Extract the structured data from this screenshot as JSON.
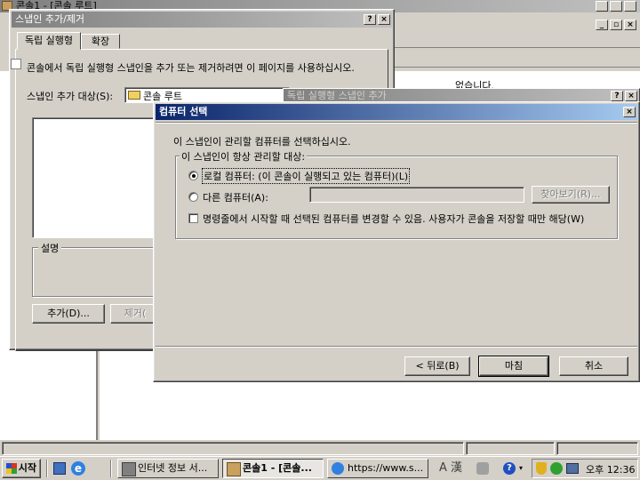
{
  "console": {
    "title": "콘솔1 - [콘솔 루트]",
    "right_text": "없습니다."
  },
  "snapin_dialog": {
    "title": "스냅인 추가/제거",
    "tabs": [
      "독립 실행형",
      "확장"
    ],
    "description": "콘솔에서 독립 실행형 스냅인을 추가 또는 제거하려면 이 페이지를 사용하십시오.",
    "add_to_label": "스냅인 추가 대상(S):",
    "add_to_value": "콘솔 루트",
    "desc_group": "설명",
    "add_button": "추가(D)...",
    "remove_button": "제거("
  },
  "add_standalone_title": "독립 실행형 스냅인 추가",
  "computer_dialog": {
    "title": "컴퓨터 선택",
    "prompt": "이 스냅인이 관리할 컴퓨터를 선택하십시오.",
    "group_label": "이 스냅인이 항상 관리할 대상:",
    "local_option": "로컬 컴퓨터: (이 콘솔이 실행되고 있는 컴퓨터)(L)",
    "other_option": "다른 컴퓨터(A):",
    "browse_button": "찾아보기(R)...",
    "checkbox_label": "명령줄에서 시작할 때 선택된 컴퓨터를 변경할 수 있음. 사용자가 콘솔을 저장할 때만 해당(W)",
    "back_button": "< 뒤로(B)",
    "finish_button": "마침",
    "cancel_button": "취소"
  },
  "taskbar": {
    "start": "시작",
    "items": [
      "인터넷 정보 서...",
      "콘솔1 - [콘솔...",
      "https://www.s..."
    ],
    "ime": "A 漢",
    "clock": "오후 12:36"
  }
}
